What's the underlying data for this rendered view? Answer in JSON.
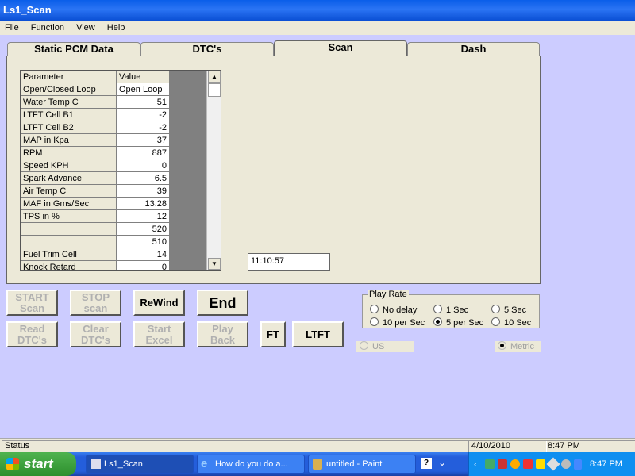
{
  "window": {
    "title": "Ls1_Scan"
  },
  "menu": {
    "items": [
      "File",
      "Function",
      "View",
      "Help"
    ]
  },
  "tabs": [
    {
      "label": "Static PCM Data",
      "active": false
    },
    {
      "label": "DTC's",
      "active": false
    },
    {
      "label": "Scan",
      "active": true
    },
    {
      "label": "Dash",
      "active": false
    }
  ],
  "grid": {
    "headers": [
      "Parameter",
      "Value"
    ],
    "rows": [
      [
        "Open/Closed Loop",
        "Open Loop"
      ],
      [
        "Water Temp C",
        "51"
      ],
      [
        "LTFT Cell B1",
        "-2"
      ],
      [
        "LTFT Cell B2",
        "-2"
      ],
      [
        "MAP in Kpa",
        "37"
      ],
      [
        "RPM",
        "887"
      ],
      [
        "Speed KPH",
        "0"
      ],
      [
        "Spark Advance",
        "6.5"
      ],
      [
        "Air Temp C",
        "39"
      ],
      [
        "MAF in Gms/Sec",
        "13.28"
      ],
      [
        "TPS in %",
        "12"
      ],
      [
        "",
        "520"
      ],
      [
        "",
        "510"
      ],
      [
        "Fuel Trim Cell",
        "14"
      ],
      [
        "Knock Retard",
        "0"
      ]
    ]
  },
  "clock": "11:10:57",
  "buttons": {
    "start_scan": "START Scan",
    "stop_scan": "STOP scan",
    "rewind": "ReWind",
    "end": "End",
    "read_dtcs": "Read DTC's",
    "clear_dtcs": "Clear DTC's",
    "start_excel": "Start Excel",
    "play_back": "Play Back",
    "ft": "FT",
    "ltft": "LTFT"
  },
  "play_rate": {
    "label": "Play Rate",
    "options": [
      "No delay",
      "1 Sec",
      "5 Sec",
      "10 per Sec",
      "5 per Sec",
      "10 Sec"
    ],
    "selected": "5 per Sec"
  },
  "units": {
    "us": "US",
    "metric": "Metric",
    "selected": "Metric"
  },
  "status": {
    "text": "Status",
    "date": "4/10/2010",
    "time": "8:47 PM"
  },
  "taskbar": {
    "start": "start",
    "tasks": [
      "Ls1_Scan",
      "How do you do a...",
      "untitled - Paint"
    ],
    "clock": "8:47 PM"
  }
}
